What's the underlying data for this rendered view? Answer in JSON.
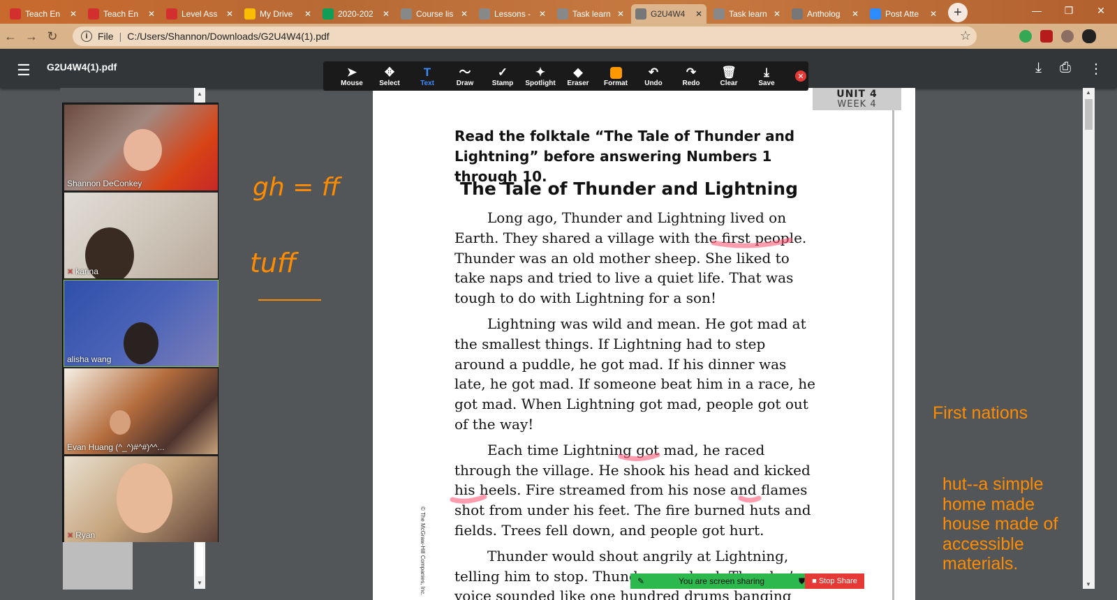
{
  "browser": {
    "tabs": [
      {
        "title": "Teach En",
        "icon": "i-ready-icon",
        "color": "#d32f2f"
      },
      {
        "title": "Teach En",
        "icon": "i-ready-icon",
        "color": "#d32f2f"
      },
      {
        "title": "Level Ass",
        "icon": "i-ready-icon",
        "color": "#d32f2f"
      },
      {
        "title": "My Drive",
        "icon": "google-drive-icon",
        "color": "#fbbc04"
      },
      {
        "title": "2020-202",
        "icon": "sheets-icon",
        "color": "#0f9d58"
      },
      {
        "title": "Course lis",
        "icon": "doc-icon",
        "color": "#888888"
      },
      {
        "title": "Lessons -",
        "icon": "doc-icon",
        "color": "#888888"
      },
      {
        "title": "Task learn",
        "icon": "doc-icon",
        "color": "#888888"
      },
      {
        "title": "G2U4W4",
        "icon": "globe-icon",
        "color": "#777777",
        "active": true
      },
      {
        "title": "Task learn",
        "icon": "doc-icon",
        "color": "#888888"
      },
      {
        "title": "Antholog",
        "icon": "globe-icon",
        "color": "#777777"
      },
      {
        "title": "Post Atte",
        "icon": "zoom-icon",
        "color": "#2d8cff"
      }
    ],
    "address": {
      "scheme": "File",
      "path": "C:/Users/Shannon/Downloads/G2U4W4(1).pdf"
    }
  },
  "pdf": {
    "filename": "G2U4W4(1).pdf"
  },
  "annotation_toolbar": {
    "tools": [
      {
        "label": "Mouse",
        "icon": "cursor-icon",
        "glyph": "➤"
      },
      {
        "label": "Select",
        "icon": "move-icon",
        "glyph": "✥"
      },
      {
        "label": "Text",
        "icon": "text-icon",
        "glyph": "T",
        "active": true
      },
      {
        "label": "Draw",
        "icon": "draw-icon",
        "glyph": "〜"
      },
      {
        "label": "Stamp",
        "icon": "stamp-icon",
        "glyph": "✓"
      },
      {
        "label": "Spotlight",
        "icon": "spotlight-icon",
        "glyph": "✦"
      },
      {
        "label": "Eraser",
        "icon": "eraser-icon",
        "glyph": "◆"
      },
      {
        "label": "Format",
        "icon": "format-icon",
        "glyph": ""
      },
      {
        "label": "Undo",
        "icon": "undo-icon",
        "glyph": "↶"
      },
      {
        "label": "Redo",
        "icon": "redo-icon",
        "glyph": "↷"
      },
      {
        "label": "Clear",
        "icon": "trash-icon",
        "glyph": "🗑"
      },
      {
        "label": "Save",
        "icon": "save-icon",
        "glyph": "⤓"
      }
    ],
    "accent": "#3d8bff",
    "format_color": "#ff9900"
  },
  "participants": [
    {
      "name": "Shannon DeConkey",
      "muted": false
    },
    {
      "name": "karina",
      "muted": true
    },
    {
      "name": "alisha wang",
      "muted": false
    },
    {
      "name": "Evan Huang (^_^)#^#)^^...",
      "muted": false
    },
    {
      "name": "Ryan",
      "muted": true
    }
  ],
  "whiteboard_notes": {
    "line1": "gh = ff",
    "line2": "tuff"
  },
  "document": {
    "unit": "UNIT 4",
    "week": "WEEK 4",
    "instructions": "Read the folktale “The Tale of Thunder and Lightning” before answering Numbers 1 through 10.",
    "title": "The Tale of Thunder and Lightning",
    "paragraphs": [
      "Long ago, Thunder and Lightning lived on Earth. They shared a village with the first people. Thunder was an old mother sheep. She liked to take naps and tried to live a quiet life. That was tough to do with Lightning for a son!",
      "Lightning was wild and mean. He got mad at the smallest things. If Lightning had to step around a puddle, he got mad. If his dinner was late, he got mad. If someone beat him in a race, he got mad. When Lightning got mad, people got out of the way!",
      "Each time Lightning got mad, he raced through the village. He shook his head and kicked his heels. Fire streamed from his nose and flames shot from under his feet. The fire burned huts and fields. Trees fell down, and people got hurt.",
      "Thunder would shout angrily at Lightning, telling him to stop. Thunder was loud. Thunder’s voice sounded like one hundred drums banging"
    ],
    "copyright": "© The McGraw-Hill Companies, Inc."
  },
  "side_notes": {
    "note1": "First nations",
    "note2": "hut--a simple home made house made of accessible materials."
  },
  "screen_share": {
    "status": "You are screen sharing",
    "stop_label": "Stop Share"
  }
}
